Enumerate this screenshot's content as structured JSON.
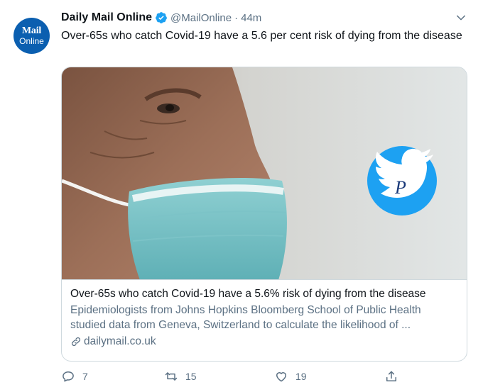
{
  "account": {
    "avatar_line1": "Mail",
    "avatar_line2": "Online",
    "display_name": "Daily Mail Online",
    "handle": "@MailOnline",
    "separator": "·",
    "time": "44m",
    "verified_color": "#1da1f2"
  },
  "tweet": {
    "text": "Over-65s who catch Covid-19 have a 5.6 per cent risk of dying from the disease"
  },
  "card": {
    "title": "Over-65s who catch Covid-19 have a 5.6% risk of dying from the disease",
    "description": "Epidemiologists from Johns Hopkins Bloomberg School of Public Health studied data from Geneva, Switzerland to calculate the likelihood of ...",
    "domain": "dailymail.co.uk",
    "image_subject": "elderly man wearing surgical face mask, side profile",
    "watermark_icon": "twitter-bird-watermark-icon"
  },
  "actions": {
    "reply_count": "7",
    "retweet_count": "15",
    "like_count": "19"
  },
  "colors": {
    "brand_blue": "#0b5fb0",
    "secondary_text": "#5b7083",
    "border": "#cfd9de"
  }
}
